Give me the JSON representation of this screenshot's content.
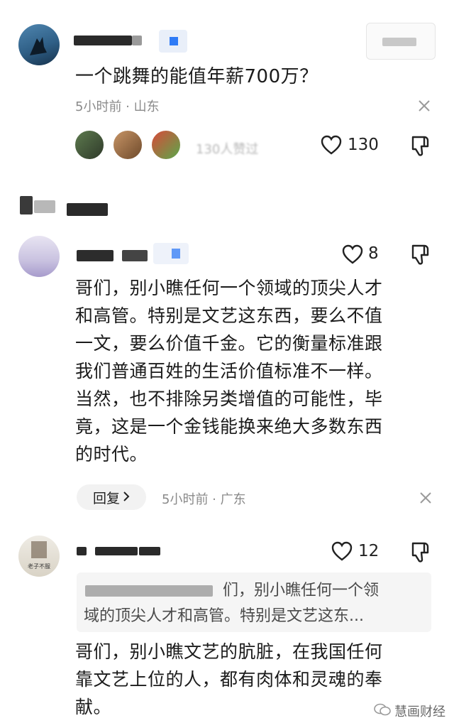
{
  "comment1": {
    "text": "一个跳舞的能值年薪700万？",
    "meta": "5小时前 · 山东",
    "reply_summary_label": "130人赞过",
    "like_count": "130"
  },
  "comment2": {
    "like_count": "8",
    "text_lines": [
      "哥们，别小瞧任何一个领域的顶尖人才",
      "和高管。特别是文艺这东西，要么不值",
      "一文，要么价值千金。它的衡量标准跟",
      "我们普通百姓的生活价值标准不一样。",
      "当然，也不排除另类增值的可能性，毕",
      "竟，这是一个金钱能换来绝大多数东西",
      "的时代。"
    ],
    "reply_button": "回复",
    "meta": "5小时前 · 广东"
  },
  "comment3": {
    "avatar_text": "老子不服",
    "like_count": "12",
    "quote_lines": [
      "们，别小瞧任何一个领",
      "域的顶尖人才和高管。特别是文艺这东..."
    ],
    "text_lines": [
      "哥们，别小瞧文艺的肮脏，在我国任何",
      "靠文艺上位的人，都有肉体和灵魂的奉",
      "献。"
    ]
  },
  "watermark": "慧画财经",
  "icons": [
    "heart-icon",
    "dislike-icon",
    "close-icon",
    "chevron-right-icon",
    "wechat-icon"
  ],
  "colors": {
    "accent_blue": "#2f7bf6",
    "meta_gray": "#8a8a8a",
    "pill_bg": "#f2f2f2"
  }
}
